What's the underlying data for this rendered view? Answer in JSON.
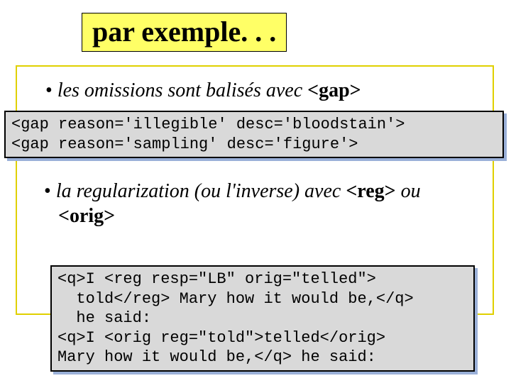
{
  "title": "par exemple. . .",
  "bullet1": {
    "text": "les omissions sont balisés avec ",
    "tag": "<gap>"
  },
  "code1": "<gap reason='illegible' desc='bloodstain'>\n<gap reason='sampling' desc='figure'>",
  "bullet2": {
    "part1": "la regularization (ou l'inverse) avec ",
    "tag1": "<reg>",
    "part2": " ou ",
    "tag2": "<orig>"
  },
  "code2": "<q>I <reg resp=\"LB\" orig=\"telled\">\n  told</reg> Mary how it would be,</q>\n  he said:\n<q>I <orig reg=\"told\">telled</orig>\nMary how it would be,</q> he said:"
}
